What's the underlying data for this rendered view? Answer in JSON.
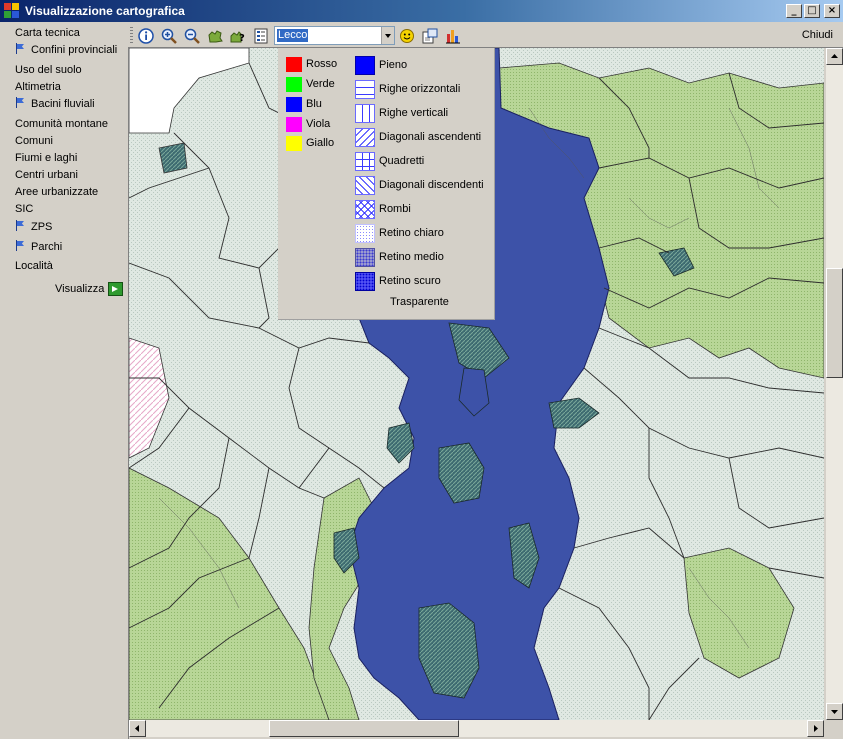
{
  "window": {
    "title": "Visualizzazione cartografica",
    "minimize": "_",
    "maximize": "□",
    "close": "×"
  },
  "sidebar": {
    "items": [
      {
        "label": "Carta tecnica",
        "flag": false
      },
      {
        "label": "Confini provinciali",
        "flag": true
      },
      {
        "label": "Uso del suolo",
        "flag": false
      },
      {
        "label": "Altimetria",
        "flag": false
      },
      {
        "label": "Bacini fluviali",
        "flag": true
      },
      {
        "label": "Comunità montane",
        "flag": false
      },
      {
        "label": "Comuni",
        "flag": false
      },
      {
        "label": "Fiumi e laghi",
        "flag": false
      },
      {
        "label": "Centri urbani",
        "flag": false
      },
      {
        "label": "Aree urbanizzate",
        "flag": false
      },
      {
        "label": "SIC",
        "flag": false
      },
      {
        "label": "ZPS",
        "flag": true
      },
      {
        "label": "Parchi",
        "flag": true
      },
      {
        "label": "Località",
        "flag": false
      }
    ],
    "visualizza": "Visualizza"
  },
  "toolbar": {
    "combo_value": "Lecco",
    "close_label": "Chiudi",
    "icons": [
      "info-icon",
      "zoom-in-icon",
      "zoom-out-icon",
      "pan-icon",
      "identify-icon",
      "legend-icon",
      "smiley-icon",
      "export-icon",
      "chart-icon"
    ]
  },
  "popup": {
    "colors": [
      {
        "label": "Rosso",
        "color": "#ff0000"
      },
      {
        "label": "Verde",
        "color": "#00ff00"
      },
      {
        "label": "Blu",
        "color": "#0000ff"
      },
      {
        "label": "Viola",
        "color": "#ff00ff"
      },
      {
        "label": "Giallo",
        "color": "#ffff00"
      }
    ],
    "patterns": [
      {
        "label": "Pieno",
        "pattern": "solid"
      },
      {
        "label": "Righe orizzontali",
        "pattern": "horizontal"
      },
      {
        "label": "Righe verticali",
        "pattern": "vertical"
      },
      {
        "label": "Diagonali ascendenti",
        "pattern": "diag-up"
      },
      {
        "label": "Quadretti",
        "pattern": "grid"
      },
      {
        "label": "Diagonali discendenti",
        "pattern": "diag-down"
      },
      {
        "label": "Rombi",
        "pattern": "diamond"
      },
      {
        "label": "Retino chiaro",
        "pattern": "dots-light"
      },
      {
        "label": "Retino medio",
        "pattern": "dots-medium"
      },
      {
        "label": "Retino scuro",
        "pattern": "dots-dark"
      }
    ],
    "transparent": "Trasparente"
  },
  "colors": {
    "lake": "#3d52a8",
    "green_area": "#b9d59a",
    "background_area": "#dde6e0",
    "outline": "#2d2d2d"
  }
}
